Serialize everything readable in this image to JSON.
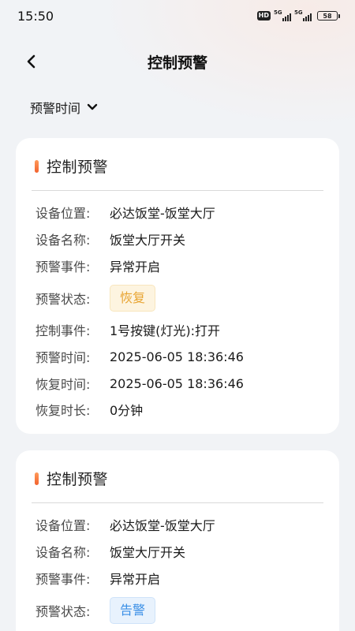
{
  "status_bar": {
    "time": "15:50",
    "hd": "HD",
    "network_1": "5G",
    "network_2": "5G",
    "battery": "58"
  },
  "header": {
    "title": "控制预警",
    "back_icon": "chevron-left-icon"
  },
  "filter": {
    "label": "预警时间",
    "icon": "chevron-down-icon"
  },
  "colors": {
    "accent_marker": "#f2622e",
    "recover_tag": "#e8a431",
    "alarm_tag": "#3a8fe6"
  },
  "cards": [
    {
      "title": "控制预警",
      "fields": [
        {
          "label": "设备位置:",
          "value": "必达饭堂-饭堂大厅"
        },
        {
          "label": "设备名称:",
          "value": "饭堂大厅开关"
        },
        {
          "label": "预警事件:",
          "value": "异常开启"
        },
        {
          "label": "预警状态:",
          "value": "恢复"
        },
        {
          "label": "控制事件:",
          "value": "1号按键(灯光):打开"
        },
        {
          "label": "预警时间:",
          "value": "2025-06-05 18:36:46"
        },
        {
          "label": "恢复时间:",
          "value": "2025-06-05 18:36:46"
        },
        {
          "label": "恢复时长:",
          "value": "0分钟"
        }
      ]
    },
    {
      "title": "控制预警",
      "fields": [
        {
          "label": "设备位置:",
          "value": "必达饭堂-饭堂大厅"
        },
        {
          "label": "设备名称:",
          "value": "饭堂大厅开关"
        },
        {
          "label": "预警事件:",
          "value": "异常开启"
        },
        {
          "label": "预警状态:",
          "value": "告警"
        }
      ]
    }
  ]
}
